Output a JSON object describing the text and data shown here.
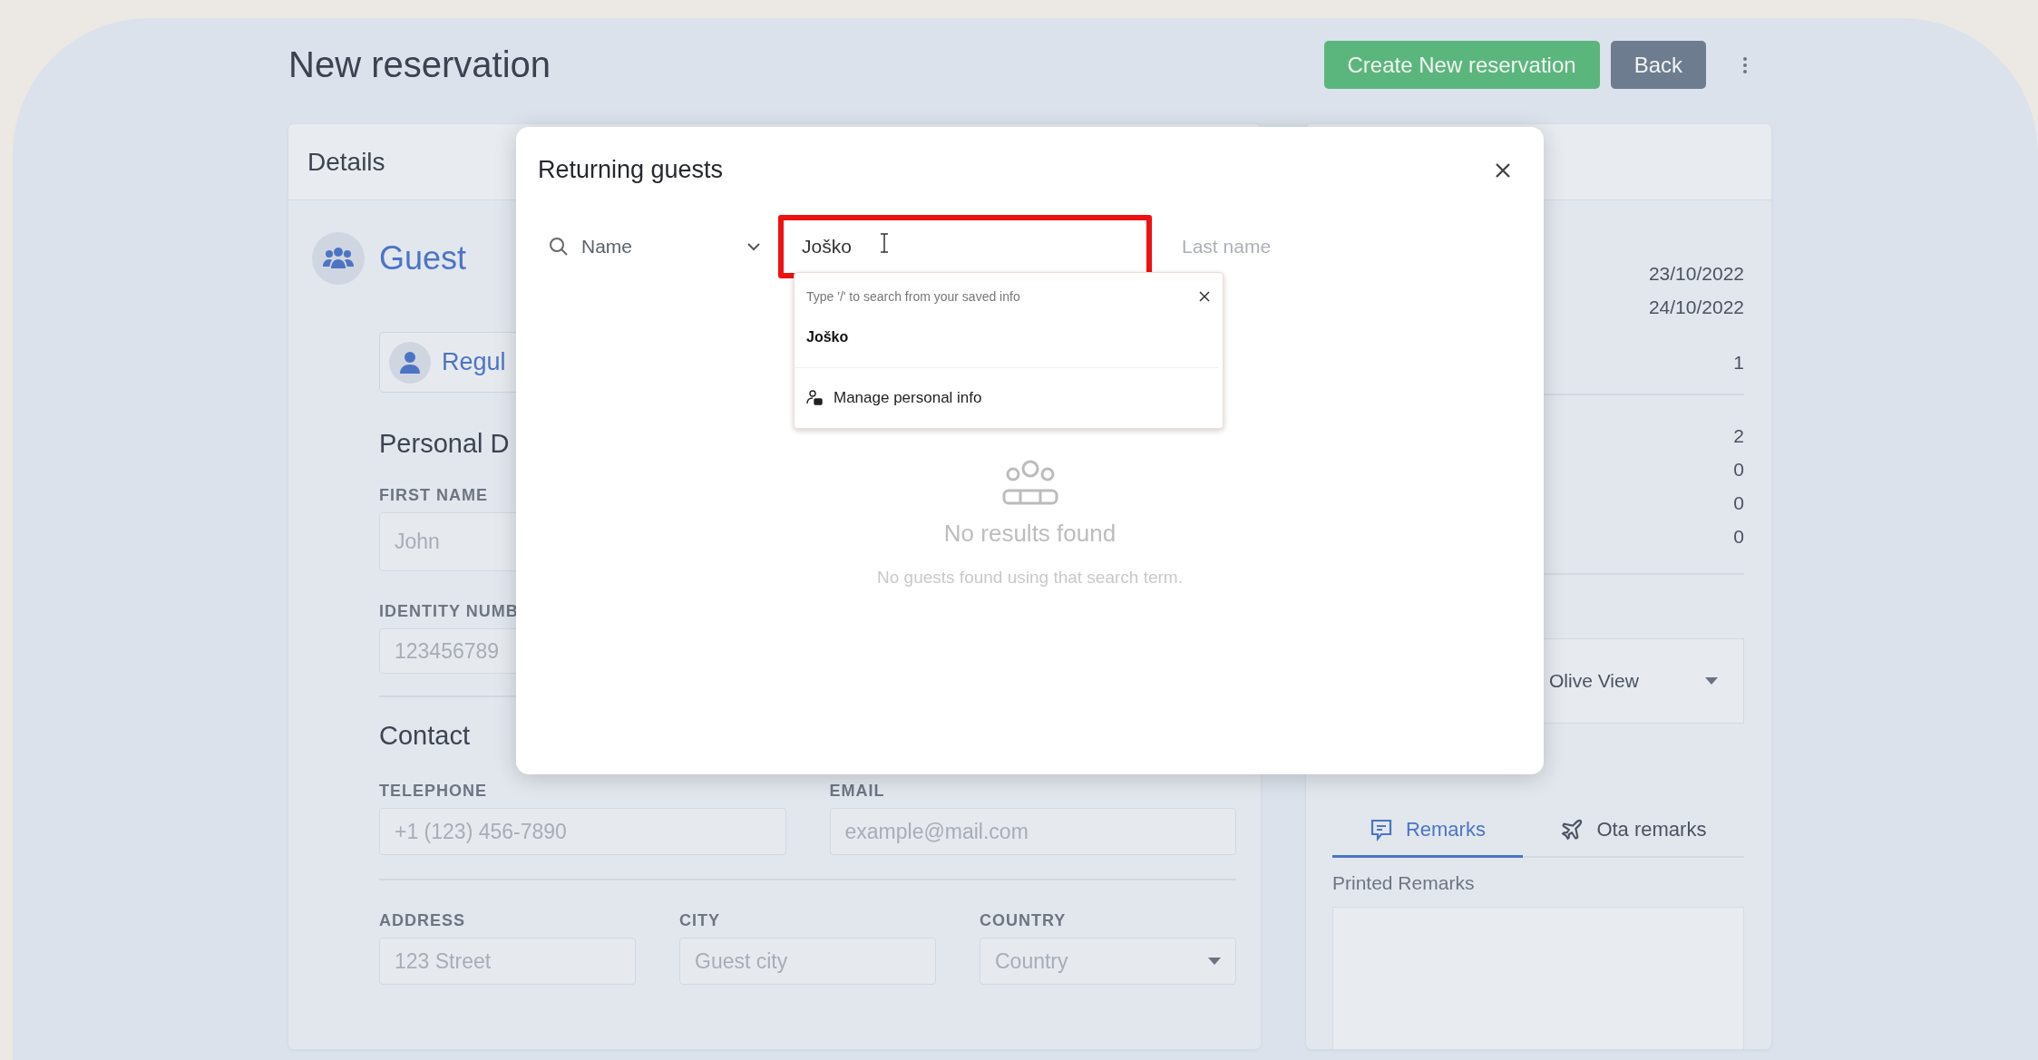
{
  "page": {
    "title": "New reservation",
    "actions": [
      {
        "label": "Create New reservation",
        "kind": "primary"
      },
      {
        "label": "Back",
        "kind": "secondary"
      }
    ]
  },
  "details": {
    "title": "Details",
    "section_title": "Guest",
    "guest_type": "Regul",
    "personal": {
      "heading": "Personal D",
      "fields": [
        {
          "label": "FIRST NAME",
          "placeholder": "John"
        },
        {
          "label": "IDENTITY NUMB",
          "placeholder": "123456789"
        }
      ]
    },
    "contact": {
      "heading": "Contact",
      "rows": [
        [
          {
            "label": "TELEPHONE",
            "placeholder": "+1 (123) 456-7890",
            "kind": "text"
          },
          {
            "label": "EMAIL",
            "placeholder": "example@mail.com",
            "kind": "text"
          }
        ],
        [
          {
            "label": "ADDRESS",
            "placeholder": "123 Street",
            "kind": "text"
          },
          {
            "label": "CITY",
            "placeholder": "Guest city",
            "kind": "text"
          },
          {
            "label": "COUNTRY",
            "placeholder": "Country",
            "kind": "select"
          }
        ]
      ]
    }
  },
  "summary": {
    "dates": [
      "23/10/2022",
      "24/10/2022",
      "1"
    ],
    "counts": [
      "2",
      "0",
      "0",
      "0"
    ],
    "room": "Olive View",
    "tabs": [
      {
        "label": "Remarks",
        "selected": true
      },
      {
        "label": "Ota remarks",
        "selected": false
      }
    ],
    "remarks_label": "Printed Remarks"
  },
  "dialog": {
    "title": "Returning guests",
    "search_by": "Name",
    "name_value": "Joško",
    "last_name_placeholder": "Last name",
    "autofill": {
      "hint": "Type '/' to search from your saved info",
      "suggestion": "Joško",
      "manage": "Manage personal info"
    },
    "empty": {
      "title": "No results found",
      "message": "No guests found using that search term."
    }
  }
}
